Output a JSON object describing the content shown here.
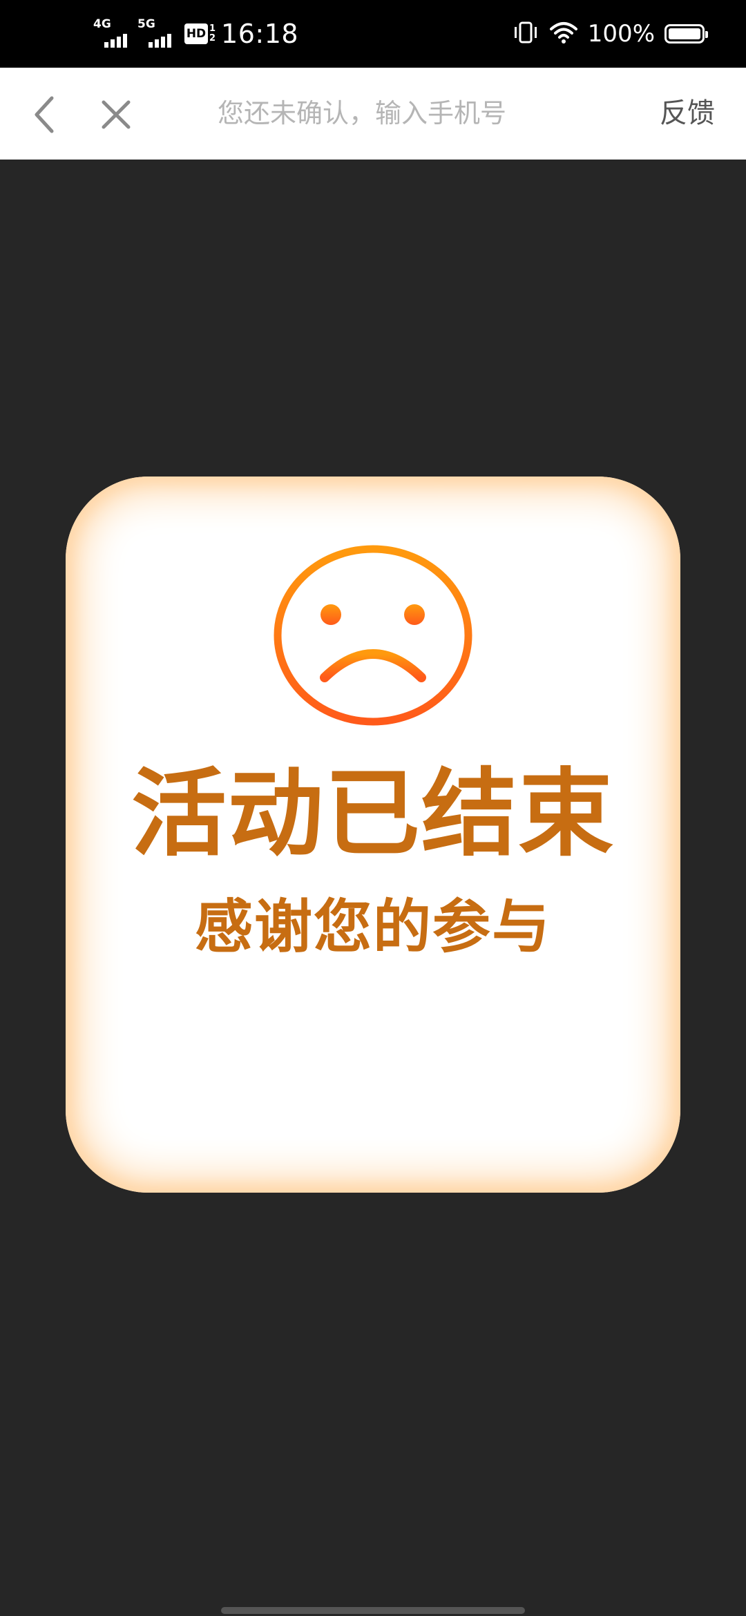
{
  "status_bar": {
    "network_1": "4G",
    "network_2": "5G",
    "hd_label": "HD",
    "hd_sub_1": "1",
    "hd_sub_2": "2",
    "time": "16:18",
    "battery_text": "100%",
    "battery_level": 1.0,
    "icons": [
      "vibrate-icon",
      "wifi-icon",
      "battery-icon"
    ]
  },
  "nav": {
    "title": "您还未确认，输入手机号",
    "feedback_label": "反馈",
    "icons": [
      "back-chevron-icon",
      "close-icon"
    ]
  },
  "card": {
    "title": "活动已结束",
    "subtitle": "感谢您的参与",
    "icon": "sad-face-icon",
    "colors": {
      "text": "#c76d12",
      "icon_gradient_start": "#ff9a0e",
      "icon_gradient_end": "#ff5a1a",
      "glow": "#ffd9ad"
    }
  },
  "colors": {
    "page_background": "#262626",
    "status_bar": "#000000",
    "nav_bar": "#ffffff"
  }
}
